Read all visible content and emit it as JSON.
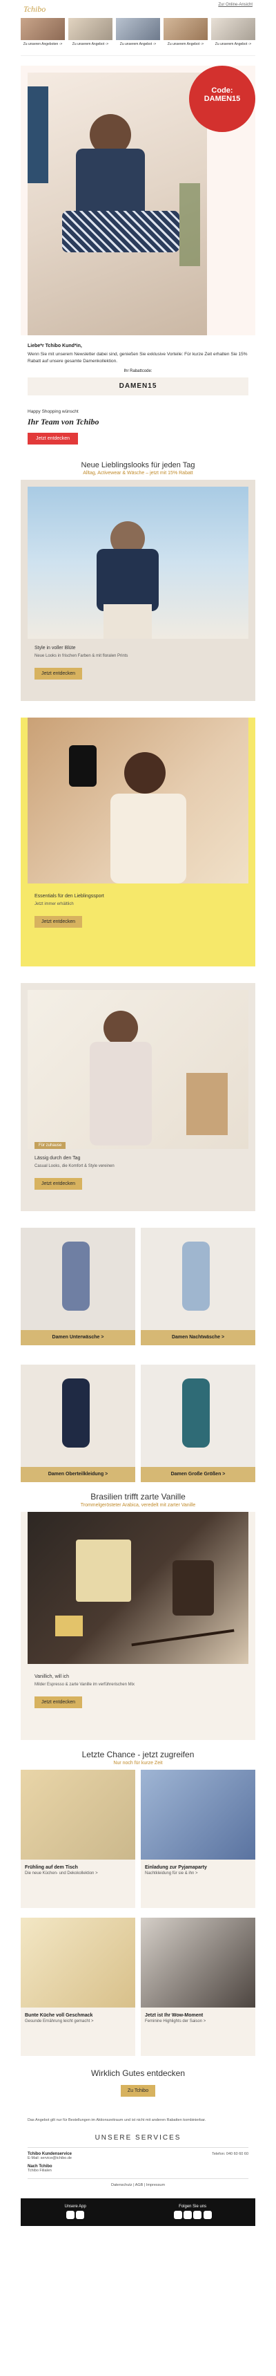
{
  "topbar": {
    "brand": "Tchibo",
    "link": "Zur Online-Ansicht"
  },
  "nav": [
    {
      "label": "Zu unseren Angeboten ->"
    },
    {
      "label": "Zu unserem Angebot ->"
    },
    {
      "label": "Zu unserem Angebot ->"
    },
    {
      "label": "Zu unserem Angebot ->"
    },
    {
      "label": "Zu unserem Angebot ->"
    }
  ],
  "hero": {
    "badge_top": "Code:",
    "badge_code": "DAMEN15"
  },
  "intro": {
    "greeting": "Liebe*r Tchibo Kund*in,",
    "text": "Wenn Sie mit unserem Newsletter dabei sind, genießen Sie exklusive Vorteile: Für kurze Zeit erhalten Sie 15% Rabatt auf unsere gesamte Damenkollektion.",
    "code_label": "Ihr Rabattcode:",
    "code": "DAMEN15",
    "signoff": "Happy Shopping wünscht",
    "signature": "Ihr Team von Tchibo",
    "cta": "Jetzt entdecken"
  },
  "section_title": "Neue Lieblingslooks für jeden Tag",
  "section_sub": "Alltag, Activewear & Wäsche – jetzt mit 15% Rabatt",
  "block1": {
    "title": "Style in voller Blüte",
    "desc": "Neue Looks in frischen Farben & mit floralen Prints",
    "cta": "Jetzt entdecken"
  },
  "block2": {
    "title": "Essentials für den Lieblingssport",
    "desc": "Jetzt immer erhältlich",
    "cta": "Jetzt entdecken"
  },
  "block3": {
    "badge": "Für zuhause",
    "title": "Lässig durch den Tag",
    "desc": "Casual Looks, die Komfort & Style vereinen",
    "cta": "Jetzt entdecken"
  },
  "grid": [
    {
      "label": "Damen Unterwäsche >"
    },
    {
      "label": "Damen Nachtwäsche >"
    },
    {
      "label": "Damen Oberteilkleidung >"
    },
    {
      "label": "Damen Große Größen >"
    }
  ],
  "coffee": {
    "headline": "Brasilien trifft zarte Vanille",
    "sub": "Trommelgerösteter Arabica, veredelt mit zarter Vanille",
    "title": "Vanillich, will ich",
    "desc": "Milder Espresso & zarte Vanille im verführerischen Mix",
    "cta": "Jetzt entdecken"
  },
  "last": {
    "title": "Letzte Chance - jetzt zugreifen",
    "sub": "Nur noch für kurze Zeit"
  },
  "products": [
    {
      "title": "Frühling auf dem Tisch",
      "desc": "Die neue Küchen- und Dekokollektion >"
    },
    {
      "title": "Einladung zur Pyjamaparty",
      "desc": "Nachtkleidung für sie & ihn >"
    },
    {
      "title": "Bunte Küche voll Geschmack",
      "desc": "Gesunde Ernährung leicht gemacht >"
    },
    {
      "title": "Jetzt ist Ihr Wow-Moment",
      "desc": "Feminine Highlights der Saison >"
    }
  ],
  "discover": {
    "title": "Wirklich Gutes entdecken",
    "cta": "Zu Tchibo"
  },
  "legal": {
    "text": "Das Angebot gilt nur für Bestellungen im Aktionszeitraum und ist nicht mit anderen Rabatten kombinierbar.",
    "services_title": "UNSERE SERVICES",
    "service1_title": "Tchibo Kundenservice",
    "service1_line1": "E-Mail: service@tchibo.de",
    "service1_line2": "Telefon: 040 60 60 60",
    "service2_title": "Nach Tchibo",
    "service2_line1": "Tchibo Filialen",
    "privacy": "Datenschutz | AGB | Impressum",
    "app_label": "Unsere App",
    "follow_label": "Folgen Sie uns"
  }
}
